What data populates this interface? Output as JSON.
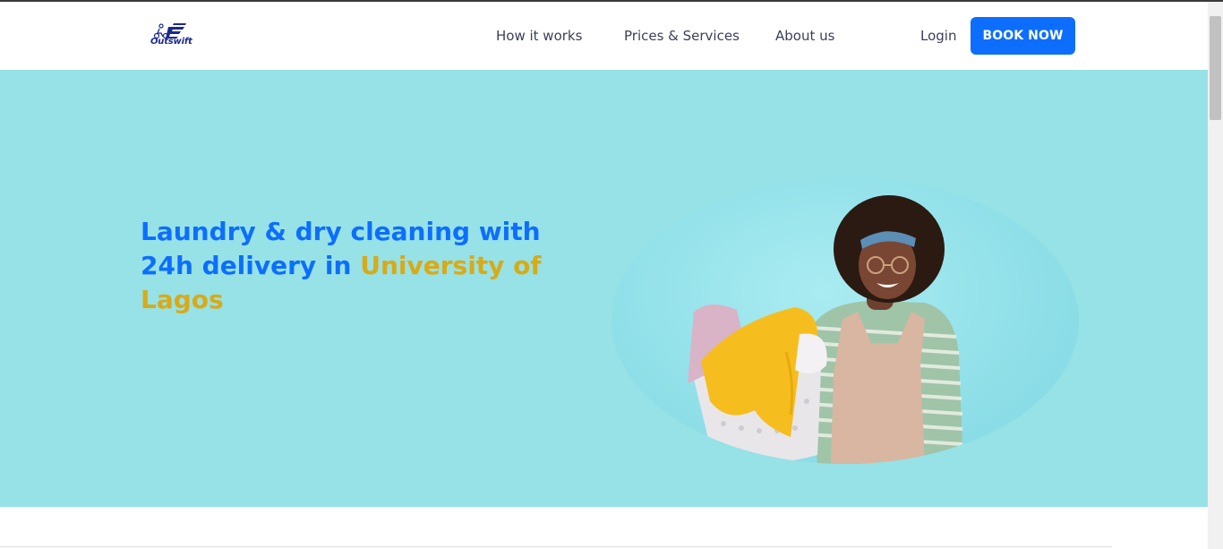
{
  "brand": {
    "name": "Outswift"
  },
  "nav": {
    "how_it_works": "How it works",
    "prices_services": "Prices & Services",
    "about_us": "About us",
    "login": "Login",
    "book_now": "BOOK NOW"
  },
  "hero": {
    "title_part1": "Laundry & dry cleaning with 24h delivery in ",
    "title_accent": "University of Lagos"
  },
  "colors": {
    "primary": "#0d6efd",
    "accent": "#d9aa16",
    "hero_bg": "#96e2e6",
    "nav_text": "#3b3f58"
  }
}
